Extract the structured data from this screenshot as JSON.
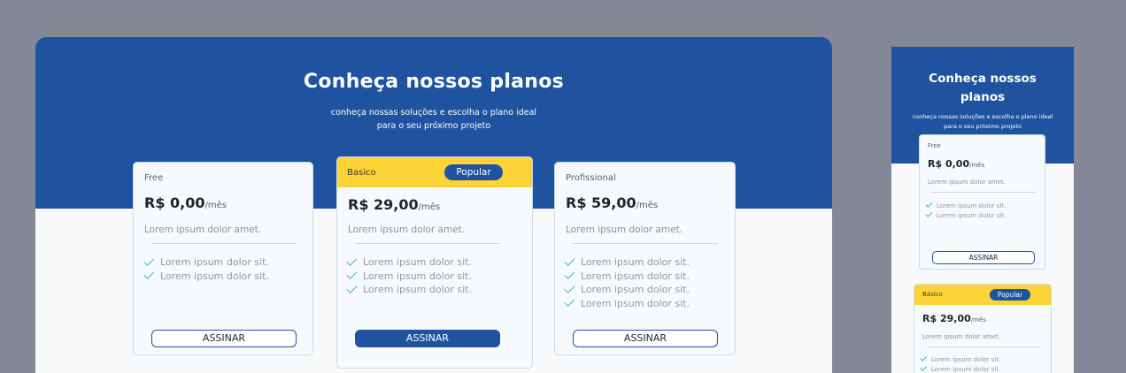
{
  "hero": {
    "title": "Conheça nossos planos",
    "subtitle_line1": "conheça nossas soluções e escolha o plano ideal",
    "subtitle_line2": "para o seu próximo projeto"
  },
  "mobile_hero": {
    "title_line1": "Conheça nossos",
    "title_line2": "planos",
    "subtitle_line1": "conheça nossas soluções e escolha o plano ideal",
    "subtitle_line2": "para o seu próximo projeto"
  },
  "plans": [
    {
      "name": "Free",
      "price": "R$ 0,00",
      "period": "/mês",
      "description": "Lorem ipsum dolor amet.",
      "features": [
        "Lorem ipsum dolor sit.",
        "Lorem ipsum dolor sit."
      ],
      "button": "ASSINAR"
    },
    {
      "name": "Basico",
      "badge": "Popular",
      "price": "R$ 29,00",
      "period": "/mês",
      "description": "Lorem ipsum dolor amet.",
      "features": [
        "Lorem ipsum dolor sit.",
        "Lorem ipsum dolor sit.",
        "Lorem ipsum dolor sit."
      ],
      "button": "ASSINAR"
    },
    {
      "name": "Profissional",
      "price": "R$ 59,00",
      "period": "/mês",
      "description": "Lorem ipsum dolor amet.",
      "features": [
        "Lorem ipsum dolor sit.",
        "Lorem ipsum dolor sit.",
        "Lorem ipsum dolor sit.",
        "Lorem ipsum dolor sit."
      ],
      "button": "ASSINAR"
    }
  ],
  "mobile_plans": [
    {
      "name": "Free",
      "price": "R$ 0,00",
      "period": "/mês",
      "description": "Lorem ipsum dolor amet.",
      "features": [
        "Lorem ipsum dolor sit.",
        "Lorem ipsum dolor sit."
      ],
      "button": "ASSINAR"
    },
    {
      "name": "Básico",
      "badge": "Popular",
      "price": "R$ 29,00",
      "period": "/mês",
      "description": "Lorem ipsum dolor amet.",
      "features": [
        "Lorem ipsum dolor sit.",
        "Lorem ipsum dolor sit."
      ]
    }
  ],
  "side_controls": {
    "up_icon": "arrow-up-circle-icon",
    "down_icon": "arrow-down-circle-icon"
  },
  "colors": {
    "primary": "#1f53a0",
    "accent": "#fdd338",
    "check": "#3fbf8a",
    "background": "#848796"
  }
}
